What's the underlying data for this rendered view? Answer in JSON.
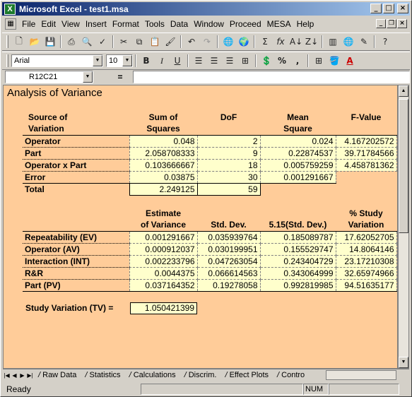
{
  "window": {
    "title": "Microsoft Excel - test1.msa",
    "app_icon": "excel-icon"
  },
  "menu": {
    "items": [
      "File",
      "Edit",
      "View",
      "Insert",
      "Format",
      "Tools",
      "Data",
      "Window",
      "Proceed",
      "MESA",
      "Help"
    ]
  },
  "formatting": {
    "font_name": "Arial",
    "font_size": "10"
  },
  "formula_bar": {
    "cell_ref": "R12C21",
    "equals": "=",
    "value": ""
  },
  "sheet": {
    "title": "Analysis of Variance",
    "anova": {
      "headers": {
        "source": [
          "Source of",
          "Variation"
        ],
        "ss": [
          "Sum of",
          "Squares"
        ],
        "dof": "DoF",
        "ms": [
          "Mean",
          "Square"
        ],
        "f": "F-Value"
      },
      "rows": [
        {
          "label": "Operator",
          "ss": "0.048",
          "dof": "2",
          "ms": "0.024",
          "f": "4.167202572"
        },
        {
          "label": "Part",
          "ss": "2.058708333",
          "dof": "9",
          "ms": "0.22874537",
          "f": "39.71784566"
        },
        {
          "label": "Operator x Part",
          "ss": "0.103666667",
          "dof": "18",
          "ms": "0.005759259",
          "f": "4.458781362"
        },
        {
          "label": "Error",
          "ss": "0.03875",
          "dof": "30",
          "ms": "0.001291667",
          "f": ""
        },
        {
          "label": "Total",
          "ss": "2.249125",
          "dof": "59",
          "ms": "",
          "f": ""
        }
      ]
    },
    "variance": {
      "headers": {
        "est": [
          "Estimate",
          "of Variance"
        ],
        "sd": "Std. Dev.",
        "sd515": "5.15(Std. Dev.)",
        "pct": [
          "% Study",
          "Variation"
        ]
      },
      "rows": [
        {
          "label": "Repeatability (EV)",
          "est": "0.001291667",
          "sd": "0.035939764",
          "sd515": "0.185089787",
          "pct": "17.62052705"
        },
        {
          "label": "Operator (AV)",
          "est": "0.000912037",
          "sd": "0.030199951",
          "sd515": "0.155529747",
          "pct": "14.8064146"
        },
        {
          "label": "Interaction (INT)",
          "est": "0.002233796",
          "sd": "0.047263054",
          "sd515": "0.243404729",
          "pct": "23.17210308"
        },
        {
          "label": "R&R",
          "est": "0.0044375",
          "sd": "0.066614563",
          "sd515": "0.343064999",
          "pct": "32.65974966"
        },
        {
          "label": "Part (PV)",
          "est": "0.037164352",
          "sd": "0.19278058",
          "sd515": "0.992819985",
          "pct": "94.51635177"
        }
      ]
    },
    "study_variation": {
      "label": "Study Variation (TV) =",
      "value": "1.050421399"
    }
  },
  "tabs": [
    "Raw Data",
    "Statistics",
    "Calculations",
    "Discrim.",
    "Effect Plots",
    "Contro"
  ],
  "status": {
    "text": "Ready",
    "num": "NUM"
  },
  "colors": {
    "sheet_bg": "#ffcc99",
    "cell_bg": "#ffffcc",
    "title_bar": "#0a246a"
  }
}
